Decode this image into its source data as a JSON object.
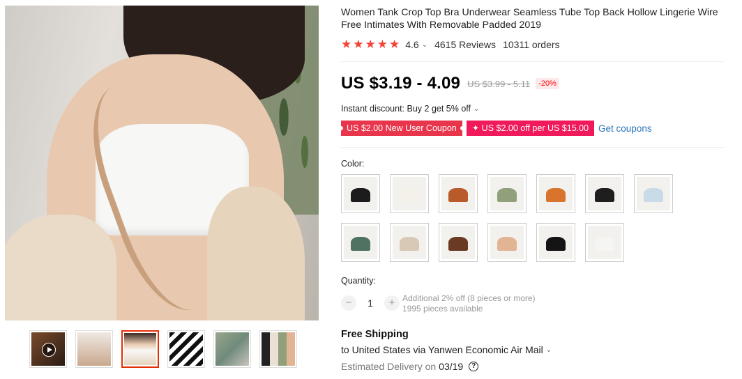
{
  "product": {
    "title": "Women Tank Crop Top Bra Underwear Seamless Tube Top Back Hollow Lingerie Wire Free Intimates With Removable Padded 2019",
    "rating": "4.6",
    "reviews": "4615 Reviews",
    "orders": "10311 orders",
    "price": "US $3.19 - 4.09",
    "original_price": "US $3.99 - 5.11",
    "discount": "-20%",
    "star_color": "#f44336"
  },
  "promo": {
    "instant_discount": "Instant discount: Buy 2 get 5% off",
    "coupon_new_user": "US $2.00 New User Coupon",
    "coupon_store": "✦ US $2.00 off per US $15.00",
    "get_coupons": "Get coupons"
  },
  "color": {
    "label": "Color:",
    "swatch_colors": [
      "#1c1c1c",
      "#f4f1ea",
      "#b85a2a",
      "#8fa07a",
      "#d8742b",
      "#1e1e1e",
      "#c9dbe8",
      "#4f7263",
      "#d8c9b6",
      "#6b3a22",
      "#e3b494",
      "#141414",
      "#f5f5f3"
    ]
  },
  "quantity": {
    "label": "Quantity:",
    "value": "1",
    "minus": "−",
    "plus": "+",
    "note_line1": "Additional 2% off (8 pieces or more)",
    "note_line2": "1995 pieces available"
  },
  "shipping": {
    "title": "Free Shipping",
    "detail": "to United States via Yanwen Economic Air Mail",
    "delivery_label": "Estimated Delivery on",
    "delivery_date": "03/19",
    "help": "?"
  },
  "icons": {
    "chevron": "⌄",
    "star": "★"
  }
}
